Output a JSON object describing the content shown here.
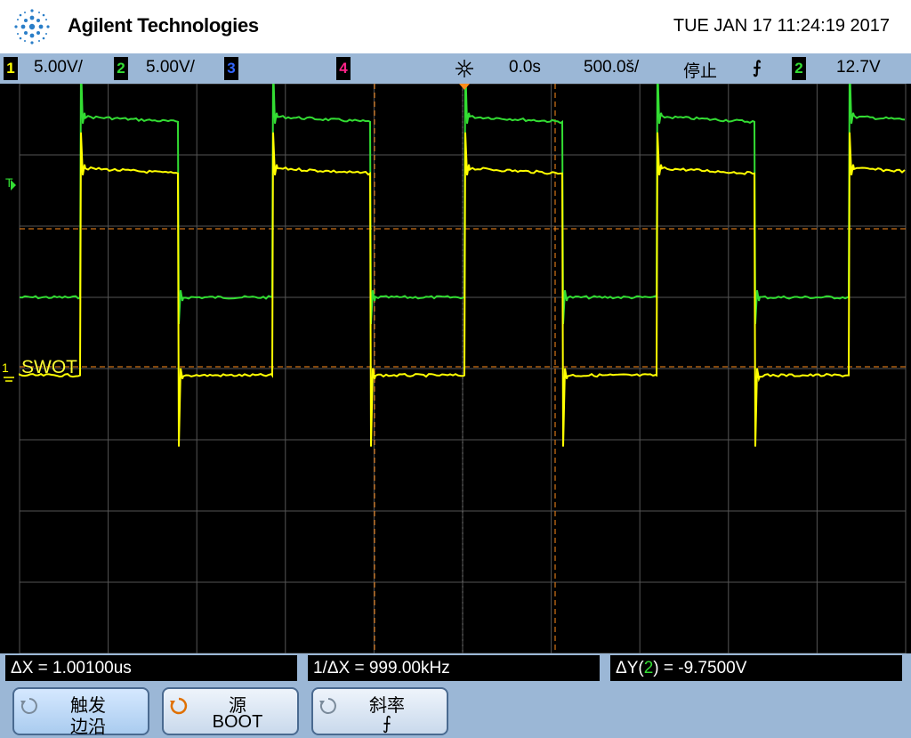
{
  "header": {
    "brand": "Agilent Technologies",
    "datetime": "TUE JAN 17 11:24:19 2017"
  },
  "statusbar": {
    "ch1_number": "1",
    "ch1_scale": "5.00V/",
    "ch2_number": "2",
    "ch2_scale": "5.00V/",
    "ch3_number": "3",
    "ch4_number": "4",
    "time_delay": "0.0s",
    "time_scale": "500.0š/",
    "run_state": "停止",
    "trigger_edge_symbol": "⨍",
    "trigger_source": "2",
    "trigger_level": "12.7V"
  },
  "screen": {
    "trigger_marker_label": "T",
    "ch1_ground_label": "1",
    "ch2_label": "SWOT"
  },
  "measurements": {
    "delta_x": "ΔX = 1.00100us",
    "inv_delta_x": "1/ΔX = 999.00kHz",
    "delta_y_prefix": "ΔY(",
    "delta_y_channel": "2",
    "delta_y_suffix": ") = -9.7500V"
  },
  "softkeys": [
    {
      "line1": "触发",
      "line2": "边沿"
    },
    {
      "line1": "源",
      "line2": "BOOT"
    },
    {
      "line1": "斜率",
      "line2": "⨍"
    }
  ],
  "colors": {
    "ch1": "#ffff00",
    "ch2": "#33dd33",
    "ch3": "#3366ff",
    "ch4": "#ff2288",
    "cursor": "#ff8c1a",
    "grid": "#555555",
    "header_bar": "#9bb7d6"
  },
  "icons": {
    "logo": "agilent-spark-icon",
    "trigger_position": "sunburst-icon",
    "softkey_knob": "rotary-knob-icon"
  },
  "waveforms": {
    "period_us": 1.0,
    "ch2_high_v": 12.7,
    "ch2_low_v": 0.0,
    "ch1_high_v": 9.75,
    "ch1_low_v": -0.3
  }
}
